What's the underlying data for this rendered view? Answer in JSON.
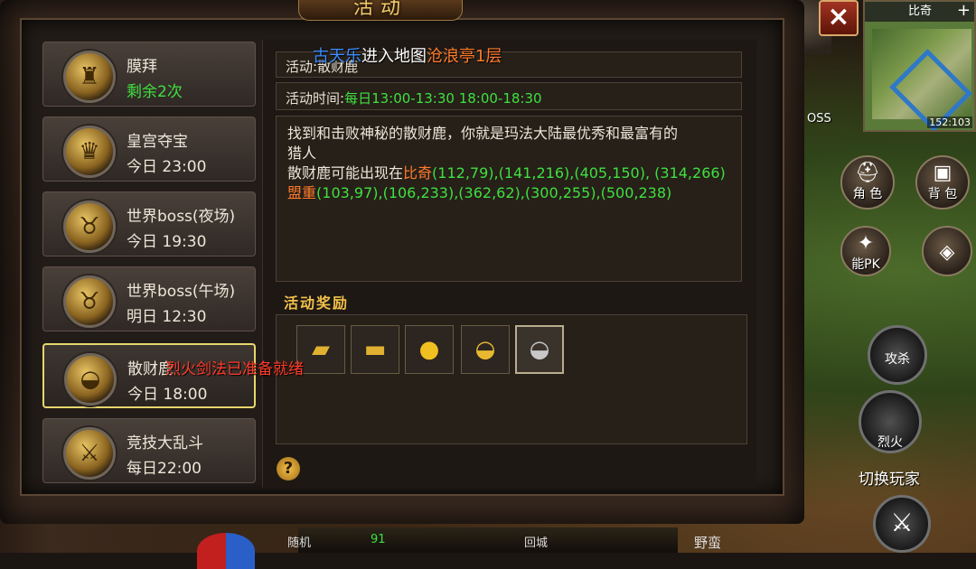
{
  "window": {
    "title": "活动",
    "close_icon": "×"
  },
  "system_message": {
    "player": "古天乐",
    "action": "进入地图",
    "map": "沧浪亭1层"
  },
  "skill_message": "烈火剑法已准备就绪",
  "activities": [
    {
      "name": "膜拜",
      "time": "剩余2次",
      "time_color": "green",
      "icon": "warrior-statue-icon",
      "glyph": "♜"
    },
    {
      "name": "皇宫夺宝",
      "time": "今日 23:00",
      "icon": "treasure-chest-icon",
      "glyph": "♛"
    },
    {
      "name": "世界boss(夜场)",
      "time": "今日 19:30",
      "icon": "bull-demon-icon",
      "glyph": "♉"
    },
    {
      "name": "世界boss(午场)",
      "time": "明日 12:30",
      "icon": "bull-demon-icon",
      "glyph": "♉"
    },
    {
      "name": "散财鹿",
      "time": "今日 18:00",
      "icon": "gold-ingot-icon",
      "glyph": "◒",
      "selected": true
    },
    {
      "name": "竞技大乱斗",
      "time": "每日22:00",
      "icon": "crossed-swords-icon",
      "glyph": "⚔"
    }
  ],
  "detail": {
    "name_label": "活动:",
    "name_value": "散财鹿",
    "time_label": "活动时间:",
    "time_value": "每日13:00-13:30 18:00-18:30",
    "desc_line1": "找到和击败神秘的散财鹿，你就是玛法大陆最优秀和最富有的",
    "desc_line2": "猎人",
    "appear_prefix": "散财鹿可能出现在",
    "loc1_name": "比奇",
    "loc1_coords": "(112,79),(141,216),(405,150), (314,266)",
    "loc2_name": "盟重",
    "loc2_coords": "(103,97),(106,233),(362,62),(300,255),(500,238)"
  },
  "rewards": {
    "title": "活动奖励",
    "items": [
      {
        "icon": "gold-bars-icon",
        "glyph": "▰"
      },
      {
        "icon": "gold-bar-icon",
        "glyph": "▬"
      },
      {
        "icon": "gold-coins-icon",
        "glyph": "●"
      },
      {
        "icon": "gold-ingot-icon",
        "glyph": "◒"
      },
      {
        "icon": "silver-ingot-icon",
        "glyph": "◒",
        "selected": true
      }
    ]
  },
  "help_label": "?",
  "minimap": {
    "map_name": "比奇",
    "zoom_label": "+",
    "coords": "152:103"
  },
  "hud": {
    "role_label": "角 色",
    "bag_label": "背 包",
    "pk_label": "能PK",
    "skill_kill_label": "攻杀",
    "skill_fire_label": "烈火",
    "switch_label": "切换玩家",
    "boss_label": "OSS",
    "random_label": "随机",
    "hp_value": "91",
    "city_label": "回城",
    "barbarian_label": "野蛮"
  },
  "colors": {
    "accent_gold": "#f2c96a",
    "green": "#3fe03f",
    "orange": "#ff7a2a",
    "blue": "#3b8cff",
    "red": "#ff3b2a"
  }
}
